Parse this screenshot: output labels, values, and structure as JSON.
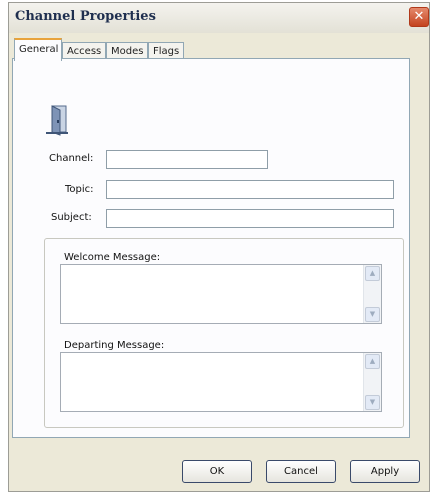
{
  "window": {
    "title": "Channel Properties",
    "close_glyph": "✕"
  },
  "tabs": [
    {
      "label": "General",
      "active": true
    },
    {
      "label": "Access",
      "active": false
    },
    {
      "label": "Modes",
      "active": false
    },
    {
      "label": "Flags",
      "active": false
    }
  ],
  "general": {
    "icon": "door-icon",
    "channel": {
      "label": "Channel:",
      "value": ""
    },
    "topic": {
      "label": "Topic:",
      "value": ""
    },
    "subject": {
      "label": "Subject:",
      "value": ""
    },
    "welcome": {
      "label": "Welcome Message:",
      "value": ""
    },
    "departing": {
      "label": "Departing Message:",
      "value": ""
    }
  },
  "buttons": {
    "ok": "OK",
    "cancel": "Cancel",
    "apply": "Apply"
  },
  "colors": {
    "window_bg": "#ece9d8",
    "active_tab_accent": "#e8a33b",
    "close_button": "#c4431f"
  }
}
